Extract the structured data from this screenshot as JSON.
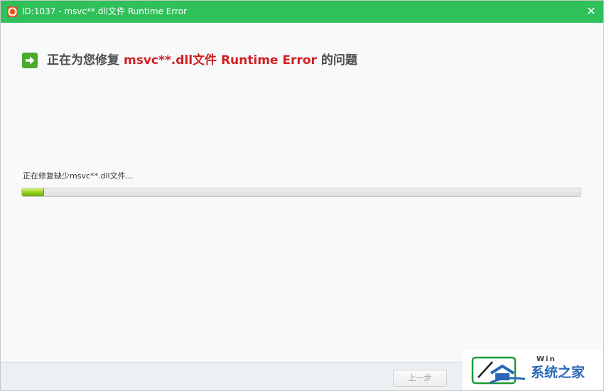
{
  "window": {
    "title": "ID:1037 - msvc**.dll文件 Runtime Error",
    "close_symbol": "✕"
  },
  "heading": {
    "prefix": "正在为您修复",
    "highlight": "msvc**.dll文件 Runtime Error",
    "suffix": "的问题"
  },
  "progress": {
    "status_text": "正在修复缺少msvc**.dll文件...",
    "percent": 4
  },
  "footer": {
    "prev_label": "上一步"
  },
  "watermark": {
    "text": "系统之家",
    "sub": "Win"
  },
  "colors": {
    "titlebar": "#2fc05a",
    "highlight": "#d21f1f",
    "progress_fill": "#8fcc1c"
  },
  "icons": {
    "app": "lifebuoy-icon",
    "heading": "arrow-right-icon",
    "close": "close-icon"
  }
}
